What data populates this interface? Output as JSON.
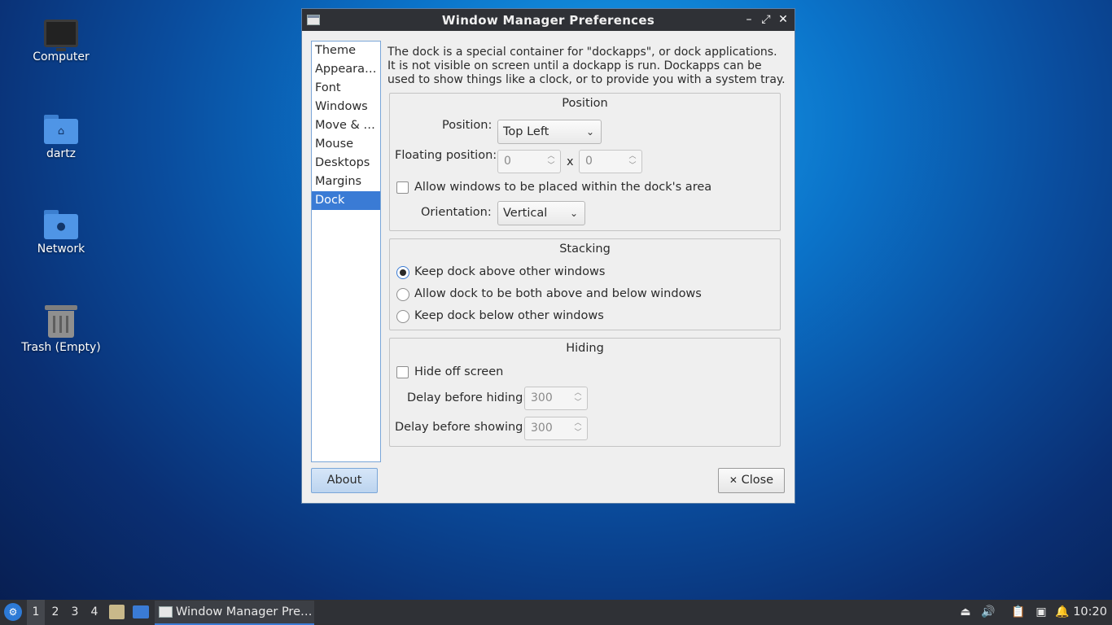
{
  "desktop": {
    "icons": [
      {
        "label": "Computer",
        "icon": "computer-icon"
      },
      {
        "label": "dartz",
        "icon": "home-folder-icon"
      },
      {
        "label": "Network",
        "icon": "network-folder-icon"
      },
      {
        "label": "Trash (Empty)",
        "icon": "trash-icon"
      }
    ]
  },
  "window": {
    "title": "Window Manager Preferences",
    "controls": {
      "minimize": "–",
      "maximize": "⤢",
      "close": "✕"
    },
    "nav": {
      "items": [
        "Theme",
        "Appeara…",
        "Font",
        "Windows",
        "Move & …",
        "Mouse",
        "Desktops",
        "Margins",
        "Dock"
      ],
      "selected": "Dock"
    },
    "description": "The dock is a special container for \"dockapps\", or dock applications.  It is not visible on screen until a dockapp is run.  Dockapps can be used to show things like a clock, or to provide you with a system tray.",
    "position_group": {
      "title": "Position",
      "position_label": "Position:",
      "position_value": "Top Left",
      "floating_label": "Floating position:",
      "floating_x": "0",
      "floating_sep": "x",
      "floating_y": "0",
      "allow_label": "Allow windows to be placed within the dock's area",
      "allow_checked": false,
      "orientation_label": "Orientation:",
      "orientation_value": "Vertical"
    },
    "stacking_group": {
      "title": "Stacking",
      "options": [
        "Keep dock above other windows",
        "Allow dock to be both above and below windows",
        "Keep dock below other windows"
      ],
      "selected_index": 0
    },
    "hiding_group": {
      "title": "Hiding",
      "hide_label": "Hide off screen",
      "hide_checked": false,
      "delay_hiding_label": "Delay before hiding:",
      "delay_hiding_value": "300",
      "delay_showing_label": "Delay before showing:",
      "delay_showing_value": "300"
    },
    "buttons": {
      "about": "About",
      "close": "Close",
      "close_icon": "✕"
    }
  },
  "taskbar": {
    "desktops": [
      "1",
      "2",
      "3",
      "4"
    ],
    "active_desktop": "1",
    "task_title": "Window Manager Pre…",
    "clock": "10:20"
  },
  "colors": {
    "accent": "#3a7bd5",
    "titlebar": "#2f3136",
    "taskbar": "#2f3136"
  }
}
